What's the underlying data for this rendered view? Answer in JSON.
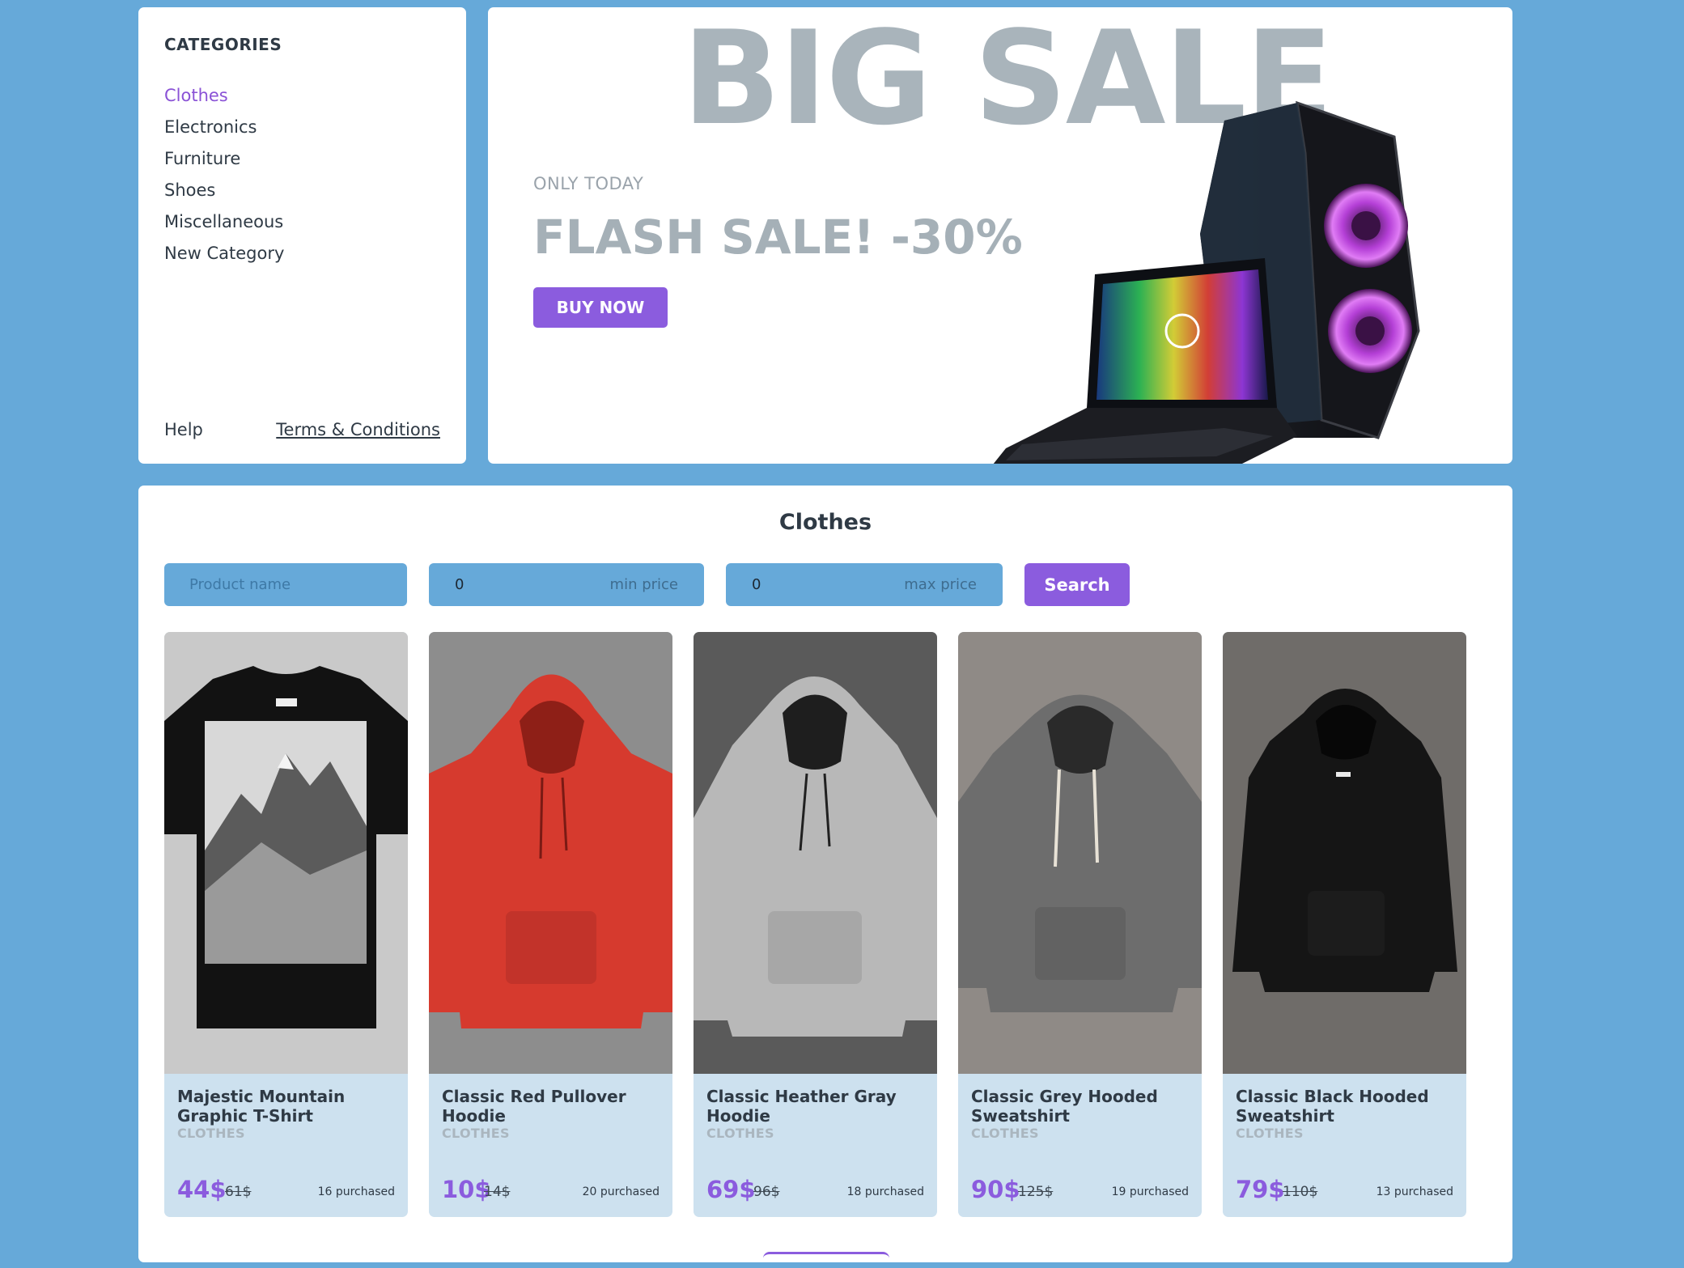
{
  "sidebar": {
    "title": "CATEGORIES",
    "categories": [
      "Clothes",
      "Electronics",
      "Furniture",
      "Shoes",
      "Miscellaneous",
      "New Category"
    ],
    "active": "Clothes",
    "help_label": "Help",
    "terms_label": "Terms & Conditions"
  },
  "banner": {
    "headline": "BIG SALE",
    "subtitle": "ONLY TODAY",
    "offer": "FLASH SALE! -30%",
    "cta_label": "BUY NOW"
  },
  "products": {
    "section_title": "Clothes",
    "filters": {
      "name_placeholder": "Product name",
      "min_value": "0",
      "min_label": "min price",
      "max_value": "0",
      "max_label": "max price",
      "search_label": "Search"
    },
    "items": [
      {
        "name": "Majestic Mountain Graphic T-Shirt",
        "category": "CLOTHES",
        "price": "44$",
        "old_price": "61$",
        "purchased": "16 purchased"
      },
      {
        "name": "Classic Red Pullover Hoodie",
        "category": "CLOTHES",
        "price": "10$",
        "old_price": "14$",
        "purchased": "20 purchased"
      },
      {
        "name": "Classic Heather Gray Hoodie",
        "category": "CLOTHES",
        "price": "69$",
        "old_price": "96$",
        "purchased": "18 purchased"
      },
      {
        "name": "Classic Grey Hooded Sweatshirt",
        "category": "CLOTHES",
        "price": "90$",
        "old_price": "125$",
        "purchased": "19 purchased"
      },
      {
        "name": "Classic Black Hooded Sweatshirt",
        "category": "CLOTHES",
        "price": "79$",
        "old_price": "110$",
        "purchased": "13 purchased"
      }
    ]
  },
  "colors": {
    "background": "#66a9d9",
    "accent": "#8b5cde",
    "card": "#cde1ef",
    "muted_heading": "#a9b4bb"
  }
}
